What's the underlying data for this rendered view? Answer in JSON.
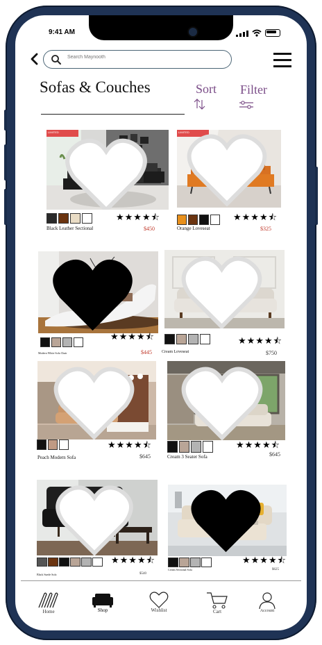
{
  "status_bar": {
    "time": "9:41 AM"
  },
  "header": {
    "search_placeholder": "Search Maynooth"
  },
  "page": {
    "title": "Sofas & Couches",
    "sort_label": "Sort",
    "filter_label": "Filter"
  },
  "products": [
    {
      "name": "Black Leather Sectional",
      "price": "$450",
      "rating": 4.5,
      "badge": "LIMITED",
      "swatches": [
        "#2a2a2a",
        "#6b3410",
        "#e9dcc5",
        "#ffffff"
      ],
      "favorited": false
    },
    {
      "name": "Orange Loveseat",
      "price": "$325",
      "rating": 4.5,
      "badge": "LIMITED",
      "swatches": [
        "#e8901c",
        "#6b3410",
        "#111111",
        "#ffffff"
      ],
      "favorited": false
    },
    {
      "name": "Modern White Sofa Chair",
      "price": "$445",
      "rating": 4.5,
      "swatches": [
        "#111111",
        "#b9a597",
        "#b3b3b3",
        "#ffffff"
      ],
      "favorited": true
    },
    {
      "name": "Cream Loveseat",
      "price": "$750",
      "rating": 4.5,
      "swatches": [
        "#111111",
        "#b9a597",
        "#b3b3b3",
        "#ffffff"
      ],
      "favorited": false
    },
    {
      "name": "Peach Modern Sofa",
      "price": "$645",
      "rating": 4.5,
      "swatches": [
        "#111111",
        "#c09a84",
        "#ffffff"
      ],
      "favorited": false
    },
    {
      "name": "Cream 3 Seater Sofa",
      "price": "$645",
      "rating": 4.5,
      "swatches": [
        "#111111",
        "#b9a597",
        "#b3b3b3",
        "#ffffff"
      ],
      "favorited": false
    },
    {
      "name": "Black Suede Sofa",
      "price": "$540",
      "rating": 4.5,
      "swatches": [
        "#555555",
        "#6b3410",
        "#111111",
        "#b9a597",
        "#b3b3b3",
        "#ffffff"
      ],
      "favorited": false
    },
    {
      "name": "Cream Sectional Sofa",
      "price": "$625",
      "rating": 4.5,
      "swatches": [
        "#111111",
        "#b9a597",
        "#b3b3b3",
        "#ffffff"
      ],
      "favorited": true
    }
  ],
  "tabs": [
    {
      "label": "Home",
      "icon": "home-logo-icon",
      "active": false
    },
    {
      "label": "Shop",
      "icon": "sofa-icon",
      "active": true
    },
    {
      "label": "Wishlist",
      "icon": "heart-icon",
      "active": false
    },
    {
      "label": "Cart",
      "icon": "cart-icon",
      "active": false
    },
    {
      "label": "Account",
      "icon": "user-icon",
      "active": false
    }
  ],
  "colors": {
    "accent": "#7b4d88",
    "price_red": "#c0392b",
    "frame": "#1f3355",
    "badge": "#e04b4b"
  }
}
